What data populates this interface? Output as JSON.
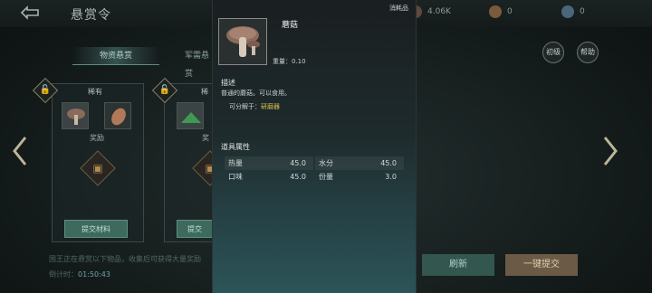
{
  "header": {
    "back_icon": "back-arrow-icon",
    "title": "悬赏令",
    "resources": [
      {
        "icon": "gem-plus-icon",
        "value": "4.06K"
      },
      {
        "icon": "coin-plus-icon",
        "value": "0"
      },
      {
        "icon": "orb-icon",
        "value": "0"
      }
    ]
  },
  "tabs": [
    {
      "label": "物资悬赏",
      "active": true
    },
    {
      "label": "军需悬赏",
      "active": false
    }
  ],
  "side_buttons": {
    "beginner": "初级",
    "help": "帮助"
  },
  "cards": [
    {
      "rarity": "稀有",
      "reward": "奖励",
      "submit_label": "提交材料",
      "lock_icon": "unlock-icon",
      "items": [
        "mushroom-icon",
        "meat-icon"
      ]
    },
    {
      "rarity": "稀",
      "reward": "奖",
      "submit_label": "提交",
      "lock_icon": "unlock-icon",
      "items": [
        "herb-icon"
      ]
    }
  ],
  "footer": {
    "notice": "国王正在悬赏以下物品，收集后可获得大量奖励",
    "timer_label": "倒计时",
    "timer_value": "01:50:43"
  },
  "actions": {
    "refresh": "刷新",
    "submit_all": "一键提交"
  },
  "popup": {
    "category_tag": "消耗品",
    "item_name": "蘑菇",
    "weight_label": "重量：",
    "weight_value": "0.10",
    "desc_title": "描述",
    "desc_text": "普通的蘑菇。可以食用。",
    "decompose_label": "可分解于：",
    "decompose_target": "研磨器",
    "attr_title": "道具属性",
    "attributes": [
      {
        "name": "热量",
        "value": "45.0"
      },
      {
        "name": "水分",
        "value": "45.0"
      },
      {
        "name": "口味",
        "value": "45.0"
      },
      {
        "name": "份量",
        "value": "3.0"
      }
    ]
  },
  "colors": {
    "accent_green": "#3e6a5e",
    "highlight_yellow": "#d6c14f",
    "refresh_btn": "#33564f",
    "submit_all_btn": "#6b5a45"
  }
}
